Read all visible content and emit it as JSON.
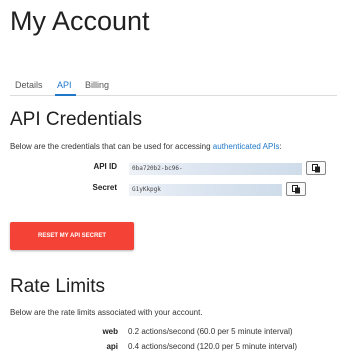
{
  "page": {
    "title": "My Account"
  },
  "tabs": [
    {
      "label": "Details",
      "active": false
    },
    {
      "label": "API",
      "active": true
    },
    {
      "label": "Billing",
      "active": false
    }
  ],
  "api_credentials": {
    "heading": "API Credentials",
    "description_prefix": "Below are the credentials that can be used for accessing ",
    "description_link": "authenticated APIs",
    "description_suffix": ":",
    "api_id": {
      "label": "API ID",
      "value": "0ba720b2-bc96-"
    },
    "secret": {
      "label": "Secret",
      "value": "G1yKkpgk"
    },
    "reset_button": "RESET MY API SECRET"
  },
  "rate_limits": {
    "heading": "Rate Limits",
    "description": "Below are the rate limits associated with your account.",
    "items": [
      {
        "name": "web",
        "value": "0.2 actions/second (60.0 per 5 minute interval)"
      },
      {
        "name": "api",
        "value": "0.4 actions/second (120.0 per 5 minute interval)"
      }
    ]
  },
  "colors": {
    "accent": "#1e77c9",
    "danger_button": "#f44336"
  },
  "icons": {
    "copy": "copy-icon"
  }
}
